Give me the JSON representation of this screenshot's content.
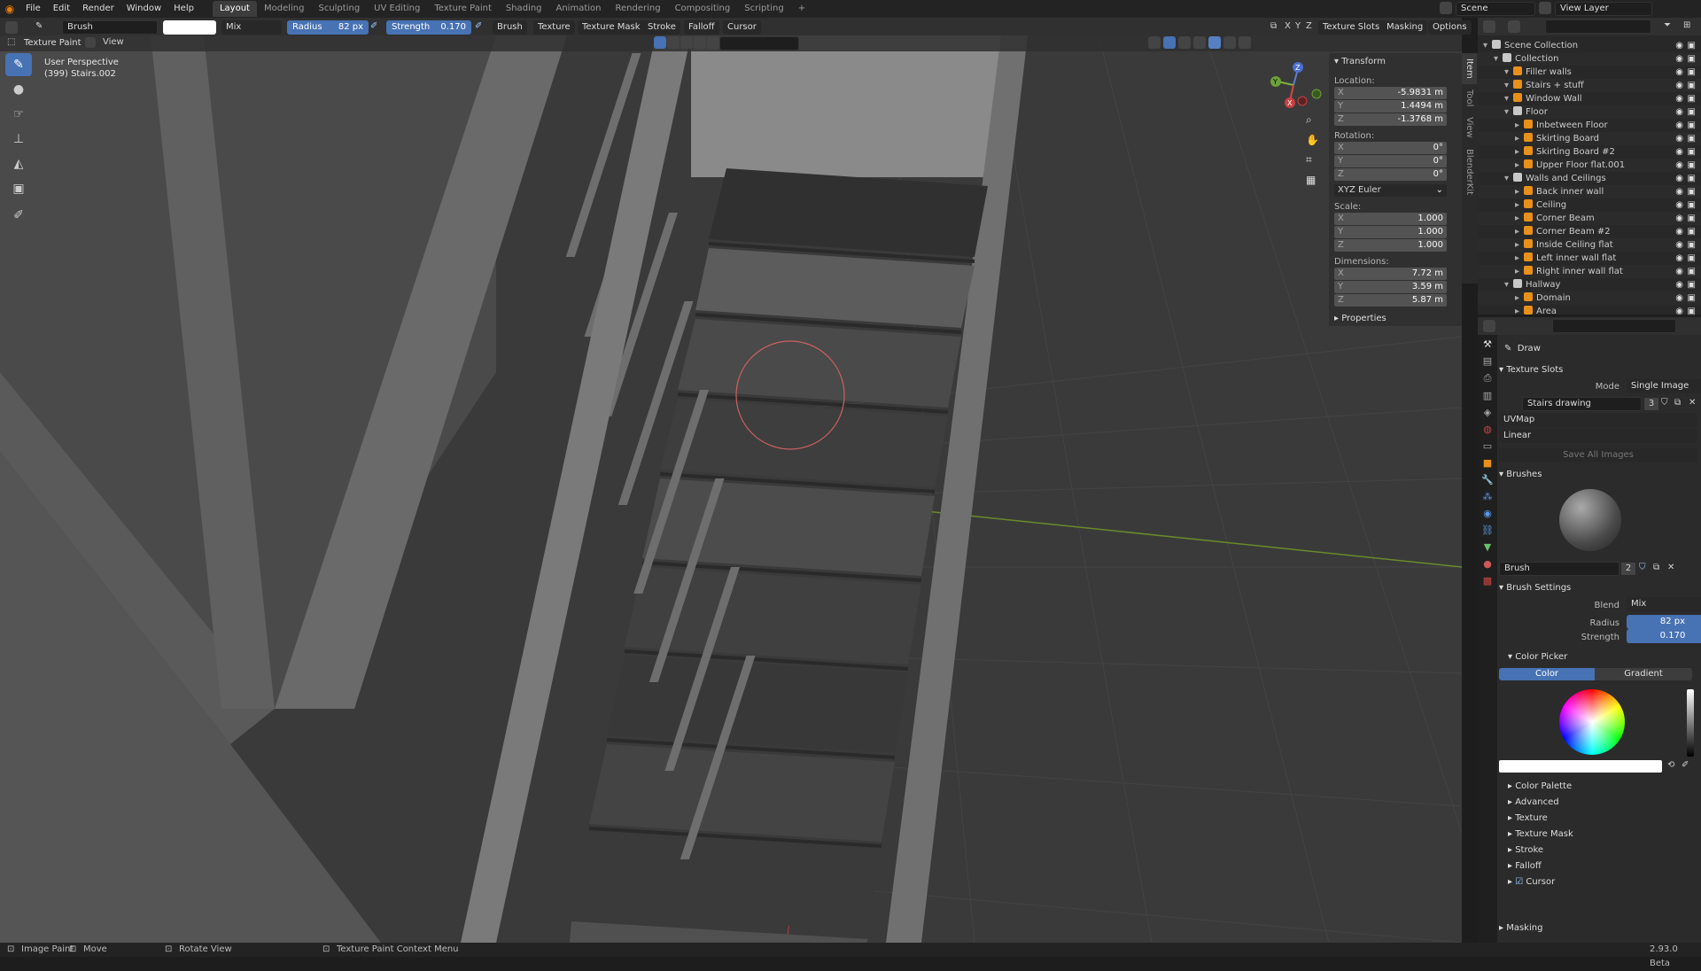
{
  "app": {
    "menus": [
      "File",
      "Edit",
      "Render",
      "Window",
      "Help"
    ],
    "workspaces": [
      "Layout",
      "Modeling",
      "Sculpting",
      "UV Editing",
      "Texture Paint",
      "Shading",
      "Animation",
      "Rendering",
      "Compositing",
      "Scripting"
    ],
    "active_workspace": "Layout",
    "scene": "Scene",
    "view_layer": "View Layer",
    "version": "2.93.0 Beta"
  },
  "tool_header": {
    "brush": "Brush",
    "blend": "Mix",
    "radius_label": "Radius",
    "radius_value": "82 px",
    "strength_label": "Strength",
    "strength_value": "0.170",
    "menus": [
      "Brush",
      "Texture",
      "Texture Mask",
      "Stroke",
      "Falloff",
      "Cursor"
    ],
    "axes": [
      "X",
      "Y",
      "Z"
    ],
    "right_menus": [
      "Texture Slots",
      "Masking",
      "Options"
    ],
    "mode": "Texture Paint",
    "view": "View"
  },
  "viewport": {
    "perspective": "User Perspective",
    "object": "(399) Stairs.002",
    "gizmo_axes": [
      "Z",
      "Y",
      "X"
    ]
  },
  "npanel": {
    "tabs": [
      "Item",
      "Tool",
      "View",
      "BlenderKit"
    ],
    "transform_title": "Transform",
    "location_label": "Location:",
    "location": [
      {
        "axis": "X",
        "value": "-5.9831 m"
      },
      {
        "axis": "Y",
        "value": "1.4494 m"
      },
      {
        "axis": "Z",
        "value": "-1.3768 m"
      }
    ],
    "rotation_label": "Rotation:",
    "rotation": [
      {
        "axis": "X",
        "value": "0°"
      },
      {
        "axis": "Y",
        "value": "0°"
      },
      {
        "axis": "Z",
        "value": "0°"
      }
    ],
    "rotation_mode": "XYZ Euler",
    "scale_label": "Scale:",
    "scale": [
      {
        "axis": "X",
        "value": "1.000"
      },
      {
        "axis": "Y",
        "value": "1.000"
      },
      {
        "axis": "Z",
        "value": "1.000"
      }
    ],
    "dimensions_label": "Dimensions:",
    "dimensions": [
      {
        "axis": "X",
        "value": "7.72 m"
      },
      {
        "axis": "Y",
        "value": "3.59 m"
      },
      {
        "axis": "Z",
        "value": "5.87 m"
      }
    ],
    "properties_title": "Properties"
  },
  "outliner": {
    "rows": [
      {
        "label": "Scene Collection",
        "indent": 0
      },
      {
        "label": "Collection",
        "indent": 1
      },
      {
        "label": "Filler walls",
        "indent": 2
      },
      {
        "label": "Stairs + stuff",
        "indent": 2
      },
      {
        "label": "Window Wall",
        "indent": 2
      },
      {
        "label": "Floor",
        "indent": 2
      },
      {
        "label": "Inbetween Floor",
        "indent": 3
      },
      {
        "label": "Skirting Board",
        "indent": 3
      },
      {
        "label": "Skirting Board #2",
        "indent": 3
      },
      {
        "label": "Upper Floor flat.001",
        "indent": 3
      },
      {
        "label": "Walls and Ceilings",
        "indent": 2
      },
      {
        "label": "Back inner wall",
        "indent": 3
      },
      {
        "label": "Ceiling",
        "indent": 3
      },
      {
        "label": "Corner Beam",
        "indent": 3
      },
      {
        "label": "Corner Beam #2",
        "indent": 3
      },
      {
        "label": "Inside Ceiling flat",
        "indent": 3
      },
      {
        "label": "Left inner wall flat",
        "indent": 3
      },
      {
        "label": "Right inner wall flat",
        "indent": 3
      },
      {
        "label": "Hallway",
        "indent": 2
      },
      {
        "label": "Domain",
        "indent": 3
      },
      {
        "label": "Area",
        "indent": 3
      }
    ]
  },
  "properties": {
    "tool_name": "Draw",
    "texture_slots_title": "Texture Slots",
    "mode_label": "Mode",
    "mode_value": "Single Image",
    "image_name": "Stairs drawing",
    "image_users": "3",
    "uvmap": "UVMap",
    "interpolation": "Linear",
    "save_all": "Save All Images",
    "brushes_title": "Brushes",
    "brush_name": "Brush",
    "brush_users": "2",
    "brush_settings_title": "Brush Settings",
    "blend_label": "Blend",
    "blend_value": "Mix",
    "radius_label": "Radius",
    "radius_value": "82 px",
    "strength_label": "Strength",
    "strength_value": "0.170",
    "color_picker_title": "Color Picker",
    "color_tab": "Color",
    "gradient_tab": "Gradient",
    "collapsed_sections": [
      "Color Palette",
      "Advanced",
      "Texture",
      "Texture Mask",
      "Stroke",
      "Falloff",
      "Cursor"
    ],
    "masking_title": "Masking"
  },
  "statusbar": {
    "items": [
      "Image Paint",
      "Move",
      "Rotate View",
      "Texture Paint Context Menu"
    ]
  }
}
